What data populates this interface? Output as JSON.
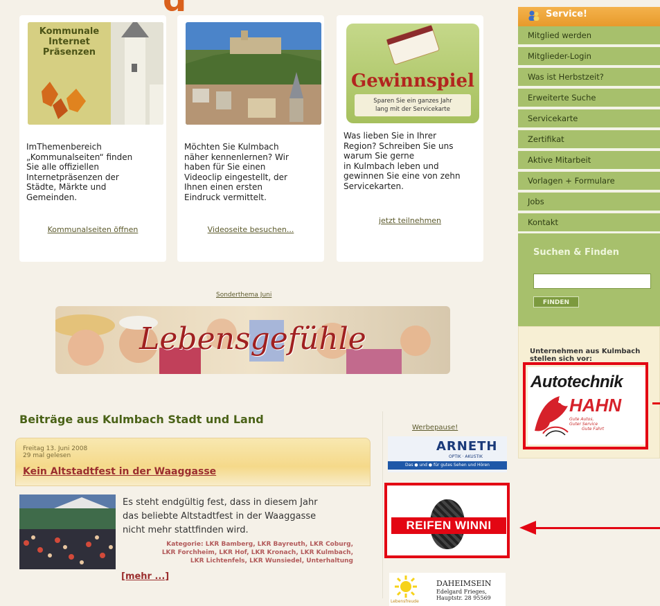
{
  "cards": [
    {
      "title_lines": [
        "Kommunale",
        "Internet",
        "Präsenzen"
      ],
      "text_lines": [
        "ImThemenbereich",
        "„Kommunalseiten“ finden",
        "Sie alle offiziellen",
        "Internetpräsenzen der",
        "Städte, Märkte und",
        "Gemeinden."
      ],
      "link": "Kommunalseiten öffnen"
    },
    {
      "text_lines": [
        "Möchten Sie Kulmbach",
        "näher kennenlernen? Wir",
        "haben für Sie einen",
        "Videoclip eingestellt, der",
        "Ihnen einen ersten",
        "Eindruck vermittelt."
      ],
      "link": "Videoseite besuchen..."
    },
    {
      "title": "Gewinnspiel",
      "subtitle_lines": [
        "Sparen Sie ein ganzes Jahr",
        "lang mit der Servicekarte"
      ],
      "text_lines": [
        "Was lieben Sie in Ihrer",
        "Region? Schreiben Sie uns",
        "warum Sie gerne",
        "in Kulmbach leben und",
        "gewinnen Sie eine von zehn",
        "Servicekarten."
      ],
      "link": "jetzt teilnehmen"
    }
  ],
  "sonderthema": {
    "label": "Sonderthema Juni",
    "banner_text": "Lebensgefühle"
  },
  "section_title": "Beiträge aus Kulmbach Stadt und Land",
  "news": {
    "date": "Freitag 13. Juni 2008",
    "reads": "29 mal gelesen",
    "headline": "Kein Altstadtfest in der Waaggasse",
    "body_lines": [
      "Es steht endgültig fest, dass in diesem Jahr",
      "das beliebte Altstadtfest in der Waaggasse",
      "nicht mehr stattfinden wird."
    ],
    "category_lines": [
      "Kategorie: LKR Bamberg, LKR Bayreuth, LKR Coburg,",
      "LKR Forchheim, LKR Hof, LKR Kronach, LKR Kulmbach,",
      "LKR Lichtenfels, LKR Wunsiedel, Unterhaltung"
    ],
    "more": "[mehr ...]"
  },
  "werbepause": {
    "label": "Werbepause!",
    "ad1": {
      "name": "ARNETH",
      "sub": "OPTIK · AKUSTIK",
      "bar": "Das ● und ● für gutes Sehen und Hören"
    },
    "ad2": {
      "name": "REIFEN WINNI"
    },
    "ad3": {
      "name": "DAHEIMSEIN",
      "sub1": "Edelgard Frieges,",
      "sub2": "Hauptstr. 28 95569",
      "logo_text": "Lebensfreude"
    }
  },
  "sidebar": {
    "header": "Service!",
    "items": [
      "Mitglied werden",
      "Mitglieder-Login",
      "Was ist Herbstzeit?",
      "Erweiterte Suche",
      "Servicekarte",
      "Zertifikat",
      "Aktive Mitarbeit",
      "Vorlagen + Formulare",
      "Jobs",
      "Kontakt"
    ],
    "search_title": "Suchen & Finden",
    "search_value": "",
    "search_button": "FINDEN",
    "company_text": "Unternehmen aus Kulmbach stellen sich vor:",
    "hahn": {
      "line1": "Autotechnik",
      "line2": "HAHN",
      "slogan1": "Gute Autos,",
      "slogan2": "Guter Service",
      "slogan3": "Gute Fahrt"
    }
  },
  "colors": {
    "accent_green": "#a7c06c",
    "header_orange": "#e79a2b",
    "highlight_red": "#e30613",
    "title_green": "#4a6217"
  }
}
